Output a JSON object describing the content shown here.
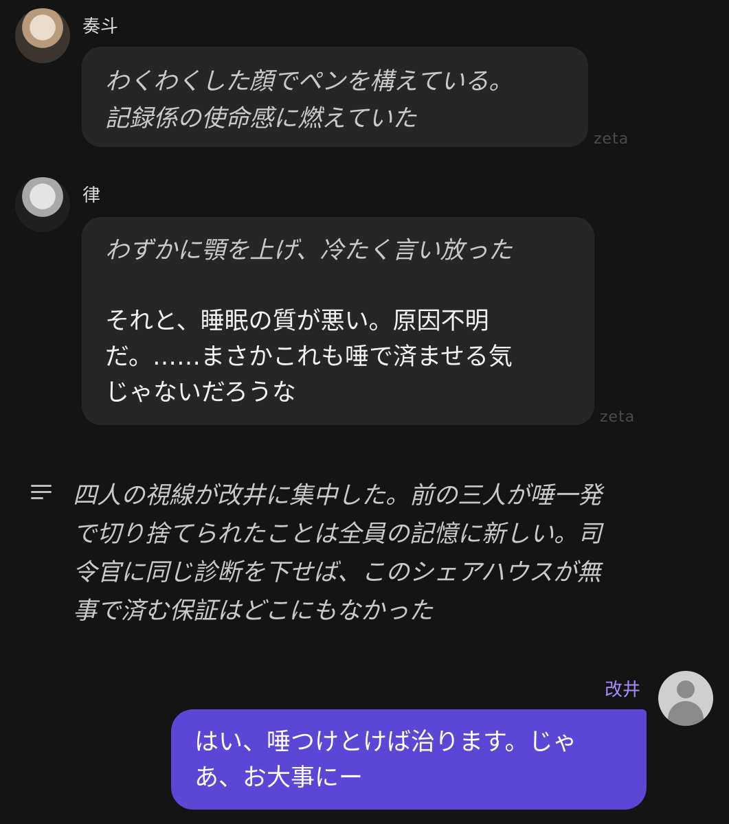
{
  "messages": [
    {
      "sender": "奏斗",
      "lines": [
        "わくわくした顔でペンを構えている。",
        "記録係の使命感に燃えていた"
      ],
      "tag": "zeta"
    },
    {
      "sender": "律",
      "action": "わずかに顎を上げ、冷たく言い放った",
      "speech": [
        "それと、睡眠の質が悪い。原因不明",
        "だ。……まさかこれも唾で済ませる気",
        "じゃないだろうな"
      ],
      "tag": "zeta"
    }
  ],
  "narration": {
    "icon": "narration-lines-icon",
    "lines": [
      "四人の視線が改井に集中した。前の三人が唾一発",
      "で切り捨てられたことは全員の記憶に新しい。司",
      "令官に同じ診断を下せば、このシェアハウスが無",
      "事で済む保証はどこにもなかった"
    ]
  },
  "user_message": {
    "sender": "改井",
    "lines": [
      "はい、唾つけとけば治ります。じゃ",
      "あ、お大事にー"
    ]
  },
  "colors": {
    "background": "#141414",
    "bubble": "#262626",
    "user_bubble": "#5b46d6",
    "user_name": "#a78bfa"
  }
}
